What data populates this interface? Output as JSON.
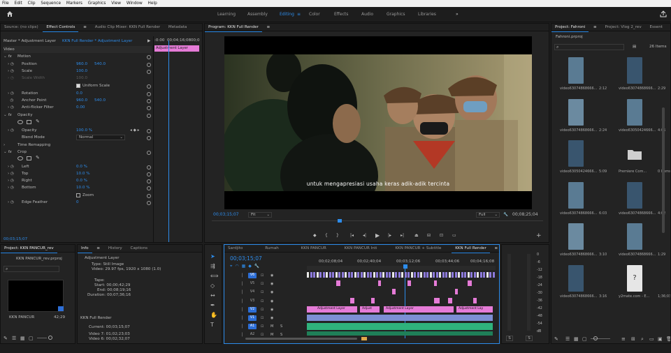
{
  "menu": [
    "File",
    "Edit",
    "Clip",
    "Sequence",
    "Markers",
    "Graphics",
    "View",
    "Window",
    "Help"
  ],
  "workspaces": [
    {
      "label": "Learning",
      "active": false
    },
    {
      "label": "Assembly",
      "active": false
    },
    {
      "label": "Editing",
      "active": true
    },
    {
      "label": "Color",
      "active": false
    },
    {
      "label": "Effects",
      "active": false
    },
    {
      "label": "Audio",
      "active": false
    },
    {
      "label": "Graphics",
      "active": false
    },
    {
      "label": "Libraries",
      "active": false
    }
  ],
  "source_panel": {
    "tabs": [
      "Source: (no clips)",
      "Effect Controls",
      "Audio Clip Mixer: KKN Full Render",
      "Metadata"
    ],
    "master": "Master * Adjustment Layer",
    "sequence_link": "KKN Full Render * Adjustment Layer",
    "ruler_start": ":0:00",
    "ruler_mid": "00;04;16;08",
    "ruler_end": "00;0",
    "clip_label": "Adjustment Layer",
    "section_video": "Video",
    "motion": "Motion",
    "position": {
      "label": "Position",
      "x": "960.0",
      "y": "540.0"
    },
    "scale": {
      "label": "Scale",
      "value": "100.0"
    },
    "scale_width": {
      "label": "Scale Width",
      "value": "100.0"
    },
    "uniform_scale": "Uniform Scale",
    "rotation": {
      "label": "Rotation",
      "value": "0.0"
    },
    "anchor_point": {
      "label": "Anchor Point",
      "x": "960.0",
      "y": "540.0"
    },
    "anti_flicker": {
      "label": "Anti-flicker Filter",
      "value": "0.00"
    },
    "opacity_title": "Opacity",
    "opacity": {
      "label": "Opacity",
      "value": "100.0 %"
    },
    "blend_mode": {
      "label": "Blend Mode",
      "value": "Normal"
    },
    "time_remapping": "Time Remapping",
    "crop": "Crop",
    "left": {
      "label": "Left",
      "value": "0.0 %"
    },
    "top": {
      "label": "Top",
      "value": "10.0 %"
    },
    "right": {
      "label": "Right",
      "value": "0.0 %"
    },
    "bottom": {
      "label": "Bottom",
      "value": "10.0 %"
    },
    "zoom": "Zoom",
    "edge_feather": {
      "label": "Edge Feather",
      "value": "0"
    },
    "timecode": "00;03;15;07"
  },
  "program": {
    "title": "Program: KKN Full Render",
    "subtitle": "untuk mengapresiasi usaha keras adik-adik tercinta",
    "timecode": "00;03;15;07",
    "fit": "Fit",
    "quality": "Full",
    "duration": "00;08;25;04"
  },
  "project_panel": {
    "tabs": [
      "Project: Fahroni",
      "Project: Vlog 2_rev",
      "Essent"
    ],
    "file": "Fahroni.prproj",
    "items_count": "26 Items",
    "items": [
      {
        "name": "video63074868666...",
        "dur": "2:12"
      },
      {
        "name": "video63074868666...",
        "dur": "2:29"
      },
      {
        "name": "video63074868666...",
        "dur": "2:24"
      },
      {
        "name": "video63050424666...",
        "dur": "4:06"
      },
      {
        "name": "video63050424666...",
        "dur": "5:09"
      },
      {
        "name": "Premiere Com...",
        "dur": "0 Items"
      },
      {
        "name": "video63074868666...",
        "dur": "6:03"
      },
      {
        "name": "video63074868666...",
        "dur": "4:02"
      },
      {
        "name": "video63074868666...",
        "dur": "3:10"
      },
      {
        "name": "video63074868666...",
        "dur": "1:29"
      },
      {
        "name": "video63074868666...",
        "dur": "3:16"
      },
      {
        "name": "y2mate.com - E...",
        "dur": "1;36;03"
      }
    ]
  },
  "bottom_project": {
    "title": "Project: KKN PANCUR_rev",
    "file": "KKN PANCUR_rev.prproj",
    "clip_name": "KKN PANCUR",
    "clip_dur": "42;29"
  },
  "info_panel": {
    "tabs": [
      "Info",
      "History",
      "Captions"
    ],
    "name": "Adjustment Layer",
    "type": "Type:  Still Image",
    "video": "Video:  29.97 fps, 1920 x 1080 (1.0)",
    "tape": "Tape:",
    "start": "Start:  00;00;42;29",
    "end": "End:  00;08;19;16",
    "duration": "Duration:  00;07;36;16",
    "seq_name": "KKN Full Render",
    "current": "Current:  00;03;15;07",
    "video1": "Video 7:  01;02;23;03",
    "video2": "Video 6:  00;02;32;07"
  },
  "timeline": {
    "tabs": [
      "Sardjito",
      "Rumah",
      "KKN PANCUR",
      "KKN PANCUR Inti",
      "KKN PANCUR + Subtitle",
      "KKN Full Render"
    ],
    "timecode": "00;03;15;07",
    "ruler": [
      "00;02;08;04",
      "00;02;40;04",
      "00;03;12;06",
      "00;03;44;06",
      "00;04;16;08"
    ],
    "video_tracks": [
      "V6",
      "V5",
      "V4",
      "V3",
      "V2",
      "V1"
    ],
    "audio_tracks": [
      "A1",
      "A2"
    ],
    "clip_labels": [
      "Adjustment Layer",
      "Adjust",
      "Adjustment Layer",
      "Adjustment Lay"
    ]
  },
  "audio_meter": {
    "scale": [
      "0",
      "-6",
      "-12",
      "-18",
      "-24",
      "-30",
      "-36",
      "-42",
      "-48",
      "-54",
      "dB"
    ],
    "solo": [
      "S",
      "S"
    ]
  },
  "colors": {
    "accent": "#2d8ceb",
    "adjustment": "#e57bd7",
    "audio": "#2fb37c",
    "video_clip": "#8c7ad9"
  }
}
